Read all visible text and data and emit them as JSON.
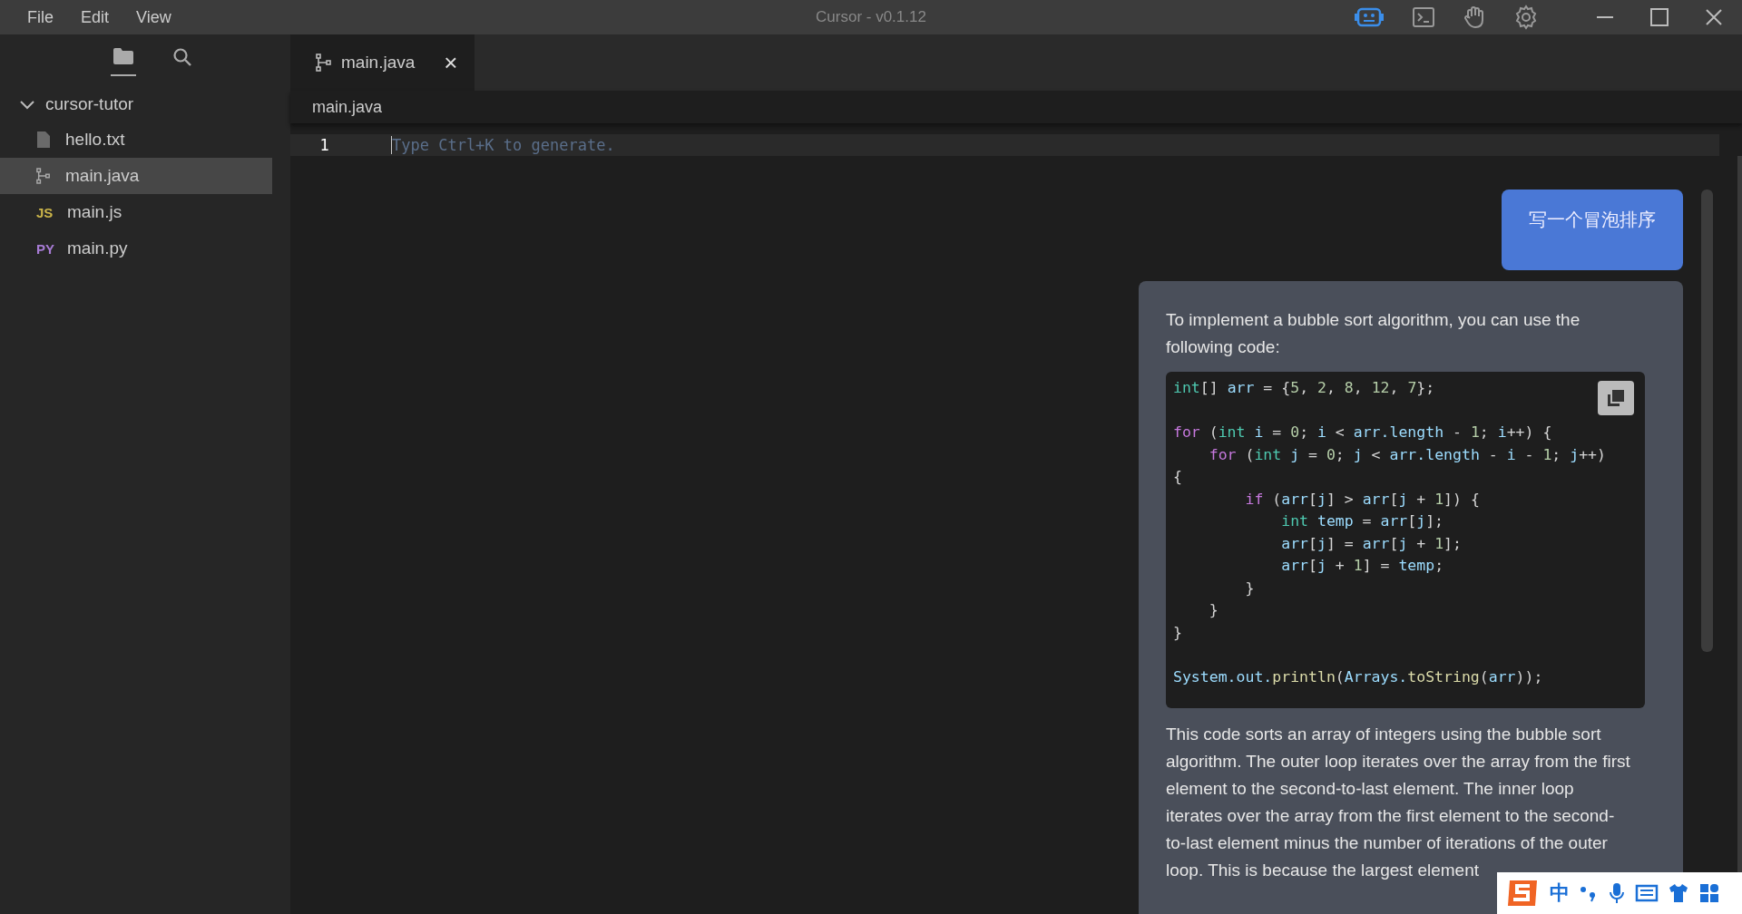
{
  "menu": [
    "File",
    "Edit",
    "View"
  ],
  "window": {
    "title": "Cursor - v0.1.12"
  },
  "toolbar": [
    {
      "kind": "chat",
      "selected": true
    },
    {
      "kind": "terminal",
      "selected": false
    },
    {
      "kind": "hand",
      "selected": false
    },
    {
      "kind": "settings",
      "selected": false
    }
  ],
  "sidebar": {
    "views": [
      {
        "kind": "files",
        "selected": true
      },
      {
        "kind": "search",
        "selected": false
      }
    ],
    "folder": {
      "name": "cursor-tutor",
      "expanded": true,
      "items": [
        {
          "name": "hello.txt",
          "kind": "file",
          "selected": false
        },
        {
          "name": "main.java",
          "kind": "java",
          "selected": true
        },
        {
          "name": "main.js",
          "kind": "badge",
          "badge": "JS",
          "color": "#cbb54a",
          "selected": false
        },
        {
          "name": "main.py",
          "kind": "badge",
          "badge": "PY",
          "color": "#a77bd4",
          "selected": false
        }
      ]
    }
  },
  "tabs": [
    {
      "label": "main.java",
      "close": "×",
      "selected": true
    }
  ],
  "breadcrumb": "main.java",
  "editor": {
    "line_number": "1",
    "placeholder": "Type Ctrl+K to generate."
  },
  "chat": {
    "user_message": "写一个冒泡排序",
    "intro": "To implement a bubble sort algorithm, you can use the following code:",
    "code": [
      {
        "kind": "code",
        "tokens": [
          {
            "kind": "type",
            "text": "int"
          },
          {
            "kind": "plain",
            "text": "[] "
          },
          {
            "kind": "var",
            "text": "arr"
          },
          {
            "kind": "plain",
            "text": " = {"
          },
          {
            "kind": "num",
            "text": "5"
          },
          {
            "kind": "plain",
            "text": ", "
          },
          {
            "kind": "num",
            "text": "2"
          },
          {
            "kind": "plain",
            "text": ", "
          },
          {
            "kind": "num",
            "text": "8"
          },
          {
            "kind": "plain",
            "text": ", "
          },
          {
            "kind": "num",
            "text": "12"
          },
          {
            "kind": "plain",
            "text": ", "
          },
          {
            "kind": "num",
            "text": "7"
          },
          {
            "kind": "plain",
            "text": "};"
          }
        ]
      },
      {
        "kind": "blank"
      },
      {
        "kind": "code",
        "tokens": [
          {
            "kind": "kw",
            "text": "for"
          },
          {
            "kind": "plain",
            "text": " ("
          },
          {
            "kind": "type",
            "text": "int"
          },
          {
            "kind": "var",
            "text": " i"
          },
          {
            "kind": "plain",
            "text": " = "
          },
          {
            "kind": "num",
            "text": "0"
          },
          {
            "kind": "plain",
            "text": "; "
          },
          {
            "kind": "var",
            "text": "i"
          },
          {
            "kind": "plain",
            "text": " < "
          },
          {
            "kind": "var",
            "text": "arr.length"
          },
          {
            "kind": "plain",
            "text": " - "
          },
          {
            "kind": "num",
            "text": "1"
          },
          {
            "kind": "plain",
            "text": "; "
          },
          {
            "kind": "var",
            "text": "i"
          },
          {
            "kind": "plain",
            "text": "++) {"
          }
        ]
      },
      {
        "kind": "code",
        "tokens": [
          {
            "kind": "kw",
            "text": "    for"
          },
          {
            "kind": "plain",
            "text": " ("
          },
          {
            "kind": "type",
            "text": "int"
          },
          {
            "kind": "var",
            "text": " j"
          },
          {
            "kind": "plain",
            "text": " = "
          },
          {
            "kind": "num",
            "text": "0"
          },
          {
            "kind": "plain",
            "text": "; "
          },
          {
            "kind": "var",
            "text": "j"
          },
          {
            "kind": "plain",
            "text": " < "
          },
          {
            "kind": "var",
            "text": "arr.length"
          },
          {
            "kind": "plain",
            "text": " - "
          },
          {
            "kind": "var",
            "text": "i"
          },
          {
            "kind": "plain",
            "text": " - "
          },
          {
            "kind": "num",
            "text": "1"
          },
          {
            "kind": "plain",
            "text": "; "
          },
          {
            "kind": "var",
            "text": "j"
          },
          {
            "kind": "plain",
            "text": "++)"
          }
        ]
      },
      {
        "kind": "code",
        "tokens": [
          {
            "kind": "plain",
            "text": "{"
          }
        ]
      },
      {
        "kind": "code",
        "tokens": [
          {
            "kind": "kw",
            "text": "        if"
          },
          {
            "kind": "plain",
            "text": " ("
          },
          {
            "kind": "var",
            "text": "arr"
          },
          {
            "kind": "plain",
            "text": "["
          },
          {
            "kind": "var",
            "text": "j"
          },
          {
            "kind": "plain",
            "text": "] > "
          },
          {
            "kind": "var",
            "text": "arr"
          },
          {
            "kind": "plain",
            "text": "["
          },
          {
            "kind": "var",
            "text": "j"
          },
          {
            "kind": "plain",
            "text": " + "
          },
          {
            "kind": "num",
            "text": "1"
          },
          {
            "kind": "plain",
            "text": "]) {"
          }
        ]
      },
      {
        "kind": "code",
        "tokens": [
          {
            "kind": "type",
            "text": "            int"
          },
          {
            "kind": "var",
            "text": " temp"
          },
          {
            "kind": "plain",
            "text": " = "
          },
          {
            "kind": "var",
            "text": "arr"
          },
          {
            "kind": "plain",
            "text": "["
          },
          {
            "kind": "var",
            "text": "j"
          },
          {
            "kind": "plain",
            "text": "];"
          }
        ]
      },
      {
        "kind": "code",
        "tokens": [
          {
            "kind": "var",
            "text": "            arr"
          },
          {
            "kind": "plain",
            "text": "["
          },
          {
            "kind": "var",
            "text": "j"
          },
          {
            "kind": "plain",
            "text": "] = "
          },
          {
            "kind": "var",
            "text": "arr"
          },
          {
            "kind": "plain",
            "text": "["
          },
          {
            "kind": "var",
            "text": "j"
          },
          {
            "kind": "plain",
            "text": " + "
          },
          {
            "kind": "num",
            "text": "1"
          },
          {
            "kind": "plain",
            "text": "];"
          }
        ]
      },
      {
        "kind": "code",
        "tokens": [
          {
            "kind": "var",
            "text": "            arr"
          },
          {
            "kind": "plain",
            "text": "["
          },
          {
            "kind": "var",
            "text": "j"
          },
          {
            "kind": "plain",
            "text": " + "
          },
          {
            "kind": "num",
            "text": "1"
          },
          {
            "kind": "plain",
            "text": "] = "
          },
          {
            "kind": "var",
            "text": "temp"
          },
          {
            "kind": "plain",
            "text": ";"
          }
        ]
      },
      {
        "kind": "code",
        "tokens": [
          {
            "kind": "plain",
            "text": "        }"
          }
        ]
      },
      {
        "kind": "code",
        "tokens": [
          {
            "kind": "plain",
            "text": "    }"
          }
        ]
      },
      {
        "kind": "code",
        "tokens": [
          {
            "kind": "plain",
            "text": "}"
          }
        ]
      },
      {
        "kind": "blank"
      },
      {
        "kind": "code",
        "tokens": [
          {
            "kind": "var",
            "text": "System.out."
          },
          {
            "kind": "method",
            "text": "println"
          },
          {
            "kind": "plain",
            "text": "("
          },
          {
            "kind": "var",
            "text": "Arrays."
          },
          {
            "kind": "method",
            "text": "toString"
          },
          {
            "kind": "plain",
            "text": "("
          },
          {
            "kind": "var",
            "text": "arr"
          },
          {
            "kind": "plain",
            "text": "));"
          }
        ]
      }
    ],
    "explanation": "This code sorts an array of integers using the bubble sort algorithm. The outer loop iterates over the array from the first element to the second-to-last element. The inner loop iterates over the array from the first element to the second-to-last element minus the number of iterations of the outer loop. This is because the largest element"
  },
  "ime_bar": {
    "mode": "中"
  }
}
